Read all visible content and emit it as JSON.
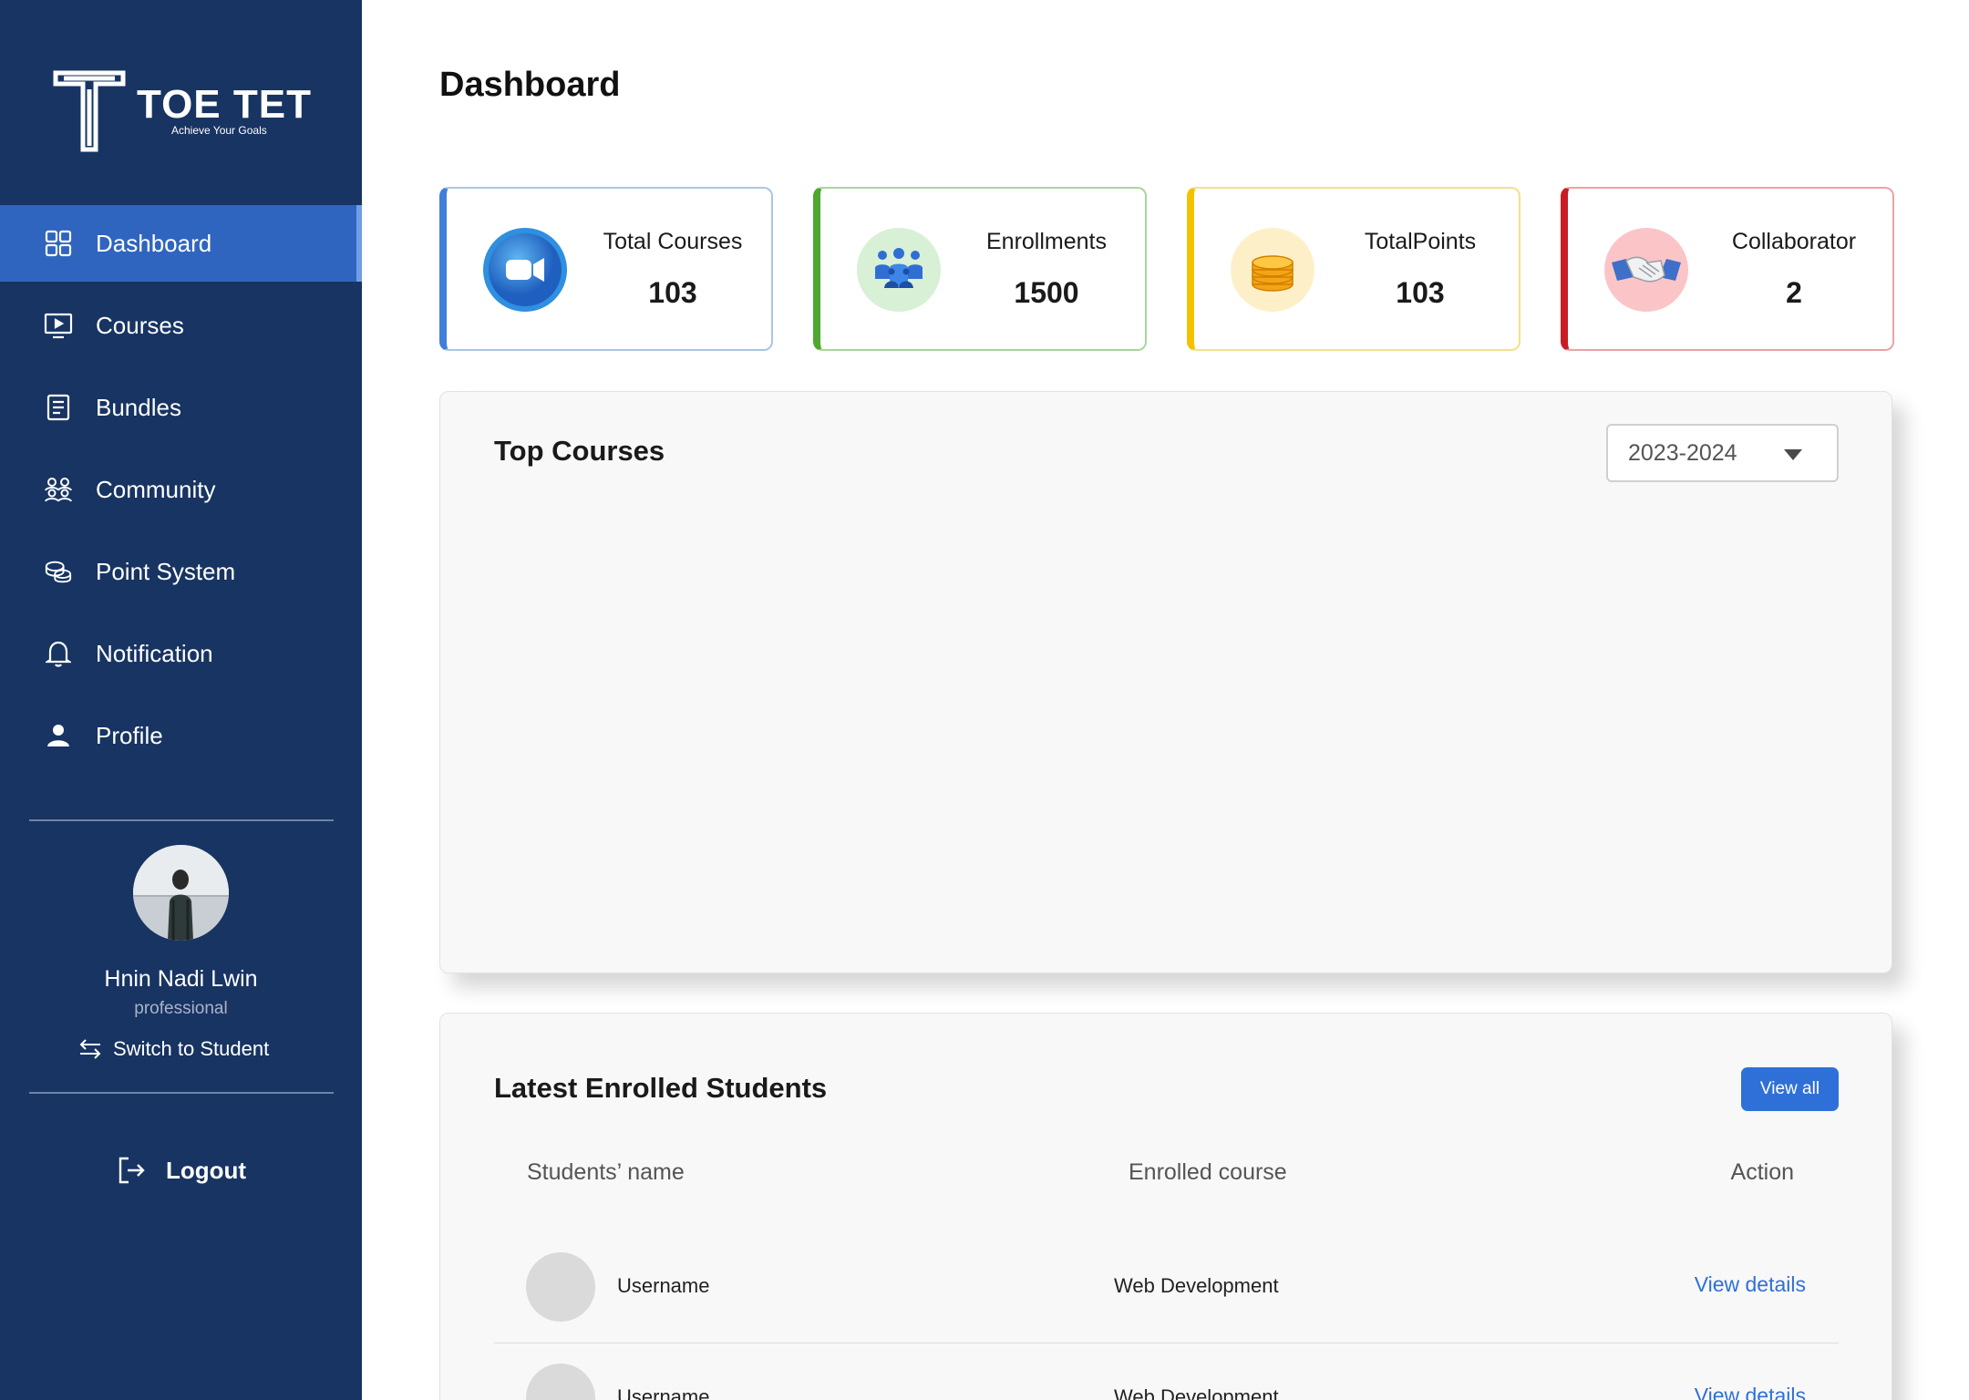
{
  "brand": {
    "name": "TOE TET",
    "tagline": "Achieve Your Goals"
  },
  "nav": {
    "dashboard": "Dashboard",
    "courses": "Courses",
    "bundles": "Bundles",
    "community": "Community",
    "point_system": "Point System",
    "notification": "Notification",
    "profile": "Profile"
  },
  "user": {
    "name": "Hnin Nadi Lwin",
    "role": "professional",
    "switch_label": "Switch to Student"
  },
  "logout_label": "Logout",
  "page_title": "Dashboard",
  "stats": {
    "courses": {
      "label": "Total Courses",
      "value": "103",
      "icon": "video-camera-icon",
      "accent": "#3f7fd9"
    },
    "enrollments": {
      "label": "Enrollments",
      "value": "1500",
      "icon": "people-icon",
      "accent": "#4ea72e"
    },
    "points": {
      "label": "TotalPoints",
      "value": "103",
      "icon": "coins-icon",
      "accent": "#f2c200"
    },
    "collaborator": {
      "label": "Collaborator",
      "value": "2",
      "icon": "handshake-icon",
      "accent": "#c81d25"
    }
  },
  "top_courses": {
    "title": "Top Courses",
    "year_selected": "2023-2024"
  },
  "latest": {
    "title": "Latest Enrolled Students",
    "view_all": "View all",
    "columns": {
      "name": "Students’ name",
      "course": "Enrolled course",
      "action": "Action"
    },
    "rows": [
      {
        "name": "Username",
        "course": "Web Development",
        "action": "View details"
      },
      {
        "name": "Username",
        "course": "Web Development",
        "action": "View details"
      }
    ]
  },
  "colors": {
    "sidebar": "#173462",
    "active": "#2f65bf",
    "link": "#2f70d8"
  }
}
